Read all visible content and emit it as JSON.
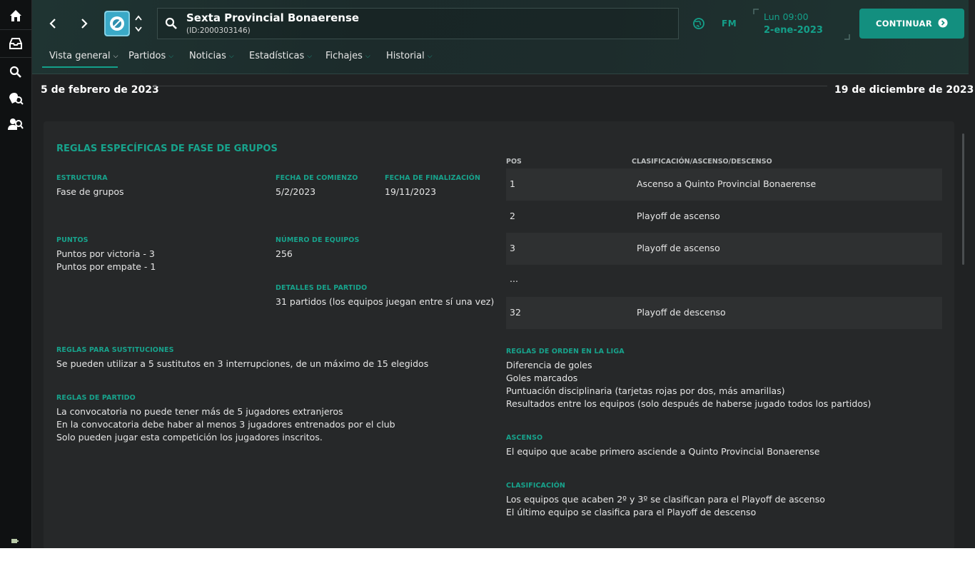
{
  "colors": {
    "accent": "#14a08a",
    "background": "#202223",
    "panel": "#262829",
    "rail": "#0f1112"
  },
  "rail": {
    "items": [
      {
        "icon": "home-icon"
      },
      {
        "icon": "inbox-icon"
      },
      {
        "icon": "search-icon"
      },
      {
        "icon": "scout-icon"
      },
      {
        "icon": "staff-search-icon"
      }
    ]
  },
  "header": {
    "title": "Sexta Provincial Bonaerense",
    "subtitle": "(ID:2000303146)",
    "fm_label": "FM",
    "date_day": "Lun 09:00",
    "date_date": "2-ene-2023",
    "continue_label": "CONTINUAR"
  },
  "tabs": [
    {
      "label": "Vista general",
      "active": true
    },
    {
      "label": "Partidos"
    },
    {
      "label": "Noticias"
    },
    {
      "label": "Estadísticas"
    },
    {
      "label": "Fichajes"
    },
    {
      "label": "Historial"
    }
  ],
  "range": {
    "start": "5 de febrero de 2023",
    "end": "19 de diciembre de 2023"
  },
  "rules": {
    "title": "REGLAS ESPECÍFICAS DE FASE DE GRUPOS",
    "estructura_label": "ESTRUCTURA",
    "estructura_value": "Fase de grupos",
    "fecha_comienzo_label": "FECHA DE COMIENZO",
    "fecha_comienzo_value": "5/2/2023",
    "fecha_fin_label": "FECHA DE FINALIZACIÓN",
    "fecha_fin_value": "19/11/2023",
    "puntos_label": "PUNTOS",
    "puntos_victoria": "Puntos por victoria - 3",
    "puntos_empate": "Puntos por empate - 1",
    "num_equipos_label": "NÚMERO DE EQUIPOS",
    "num_equipos_value": "256",
    "detalles_label": "DETALLES DEL PARTIDO",
    "detalles_value": "31 partidos (los equipos juegan entre sí una vez)",
    "sustituciones_label": "REGLAS PARA SUSTITUCIONES",
    "sustituciones_value": "Se pueden utilizar a 5 sustitutos en 3 interrupciones, de un máximo de 15 elegidos",
    "partido_label": "REGLAS DE PARTIDO",
    "partido_lines": [
      "La convocatoria no puede tener más de 5 jugadores extranjeros",
      "En la convocatoria debe haber al menos 3 jugadores entrenados por el club",
      "Solo pueden jugar esta competición los jugadores inscritos."
    ]
  },
  "standings": {
    "col_pos": "POS",
    "col_desc": "CLASIFICACIÓN/ASCENSO/DESCENSO",
    "rows": [
      {
        "pos": "1",
        "desc": "Ascenso a Quinto Provincial Bonaerense"
      },
      {
        "pos": "2",
        "desc": "Playoff de ascenso"
      },
      {
        "pos": "3",
        "desc": "Playoff de ascenso"
      },
      {
        "pos": "...",
        "desc": ""
      },
      {
        "pos": "32",
        "desc": "Playoff de descenso"
      }
    ]
  },
  "orden": {
    "label": "REGLAS DE ORDEN EN LA LIGA",
    "lines": [
      "Diferencia de goles",
      "Goles marcados",
      "Puntuación disciplinaria (tarjetas rojas por dos, más amarillas)",
      "Resultados entre los equipos (solo después de haberse jugado todos los partidos)"
    ]
  },
  "ascenso": {
    "label": "ASCENSO",
    "value": "El equipo que acabe primero asciende a Quinto Provincial Bonaerense"
  },
  "clasificacion": {
    "label": "CLASIFICACIÓN",
    "lines": [
      "Los equipos que acaben 2º y 3º se clasifican para el Playoff de ascenso",
      "El último equipo se clasifica para el Playoff de descenso"
    ]
  }
}
